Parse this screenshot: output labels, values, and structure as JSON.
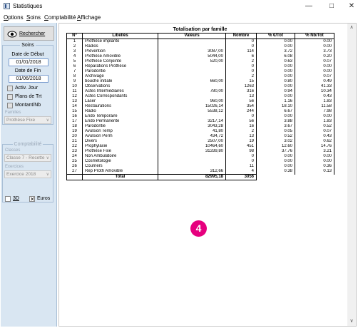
{
  "window": {
    "title": "Statistiques"
  },
  "menu": [
    "Options",
    "Soins",
    "Comptabilité",
    "Affichage"
  ],
  "sidebar": {
    "search_label": "Rechercher",
    "soins_legend": "Soins",
    "date_debut_label": "Date de Début",
    "date_debut": "01/01/2018",
    "date_fin_label": "Date de Fin",
    "date_fin": "01/06/2018",
    "buttons": [
      "Activ. Jour",
      "Plans de Trt",
      "Montant/Nb"
    ],
    "familles_label": "Familles",
    "famille_value": "Prothèse Fixe",
    "compta_legend": "Comptabilité",
    "classes_label": "Classes",
    "classe_value": "Classe 7 - Recette",
    "exercices_label": "Exercices",
    "exercice_value": "Exercice 2018",
    "check_3d": "3D",
    "check_euros": "Euros"
  },
  "report": {
    "title": "Totalisation par famille",
    "columns": [
      "N°",
      "Libellés",
      "Valeurs",
      "Nombre",
      "% €/Tot",
      "% Nb/Tot"
    ],
    "rows": [
      [
        "1",
        "Prothèse implanto",
        "",
        "0",
        "0.00",
        "0.00"
      ],
      [
        "2",
        "Radios",
        "",
        "0",
        "0.00",
        "0.00"
      ],
      [
        "3",
        "Prévention",
        "3087,00",
        "114",
        "3.72",
        "3.73"
      ],
      [
        "4",
        "Prothèse Amovible",
        "5044,00",
        "6",
        "6.08",
        "0.20"
      ],
      [
        "5",
        "Prothèse Conjointe",
        "520,00",
        "2",
        "0.63",
        "0.07"
      ],
      [
        "6",
        "Réparations Prothèse",
        "",
        "0",
        "0.00",
        "0.00"
      ],
      [
        "7",
        "Parodontie",
        "",
        "0",
        "0.00",
        "0.00"
      ],
      [
        "8",
        "Archivage",
        "",
        "2",
        "0.00",
        "0.07"
      ],
      [
        "9",
        "bouche initiale",
        "660,00",
        "15",
        "0.80",
        "0.49"
      ],
      [
        "10",
        "Observations",
        "",
        "1263",
        "0.00",
        "41.33"
      ],
      [
        "11",
        "Actes Intermédiaires",
        "780,00",
        "316",
        "0.94",
        "10.34"
      ],
      [
        "12",
        "Actes Correspondants",
        "",
        "13",
        "0.00",
        "0.43"
      ],
      [
        "13",
        "Laser",
        "960,00",
        "56",
        "1.16",
        "1.83"
      ],
      [
        "14",
        "Restaurations",
        "15026,14",
        "354",
        "18.10",
        "11.58"
      ],
      [
        "15",
        "Radio",
        "5538,12",
        "244",
        "6.67",
        "7.98"
      ],
      [
        "16",
        "Endo Temporaire",
        "",
        "0",
        "0.00",
        "0.00"
      ],
      [
        "17",
        "Endo Permanente",
        "3217,14",
        "56",
        "3.88",
        "1.83"
      ],
      [
        "18",
        "Parodontie",
        "3043,28",
        "16",
        "3.67",
        "0.52"
      ],
      [
        "19",
        "Avulsion Temp",
        "41,80",
        "2",
        "0.05",
        "0.07"
      ],
      [
        "20",
        "Avulsion Perm",
        "434,72",
        "13",
        "0.52",
        "0.43"
      ],
      [
        "21",
        "Divers",
        "2507,00",
        "19",
        "3.02",
        "0.62"
      ],
      [
        "22",
        "Prophylaxie",
        "10464,60",
        "451",
        "12.60",
        "14.76"
      ],
      [
        "23",
        "Prothèse Fixe",
        "31339,80",
        "98",
        "37.76",
        "3.21"
      ],
      [
        "24",
        "Non Ambulatoire",
        "",
        "0",
        "0.00",
        "0.00"
      ],
      [
        "25",
        "Cosmétologie",
        "",
        "0",
        "0.00",
        "0.00"
      ],
      [
        "26",
        "Courriers",
        "",
        "11",
        "0.00",
        "0.36"
      ],
      [
        "27",
        "Rep Proth Amovible",
        "312,66",
        "4",
        "0.38",
        "0.13"
      ]
    ],
    "total_label": "Total",
    "total_value": "82995,18",
    "total_count": "3056"
  },
  "badge": "4",
  "colors": {
    "sidebar_bg": "#d9e6f2",
    "badge": "#e6007e"
  }
}
